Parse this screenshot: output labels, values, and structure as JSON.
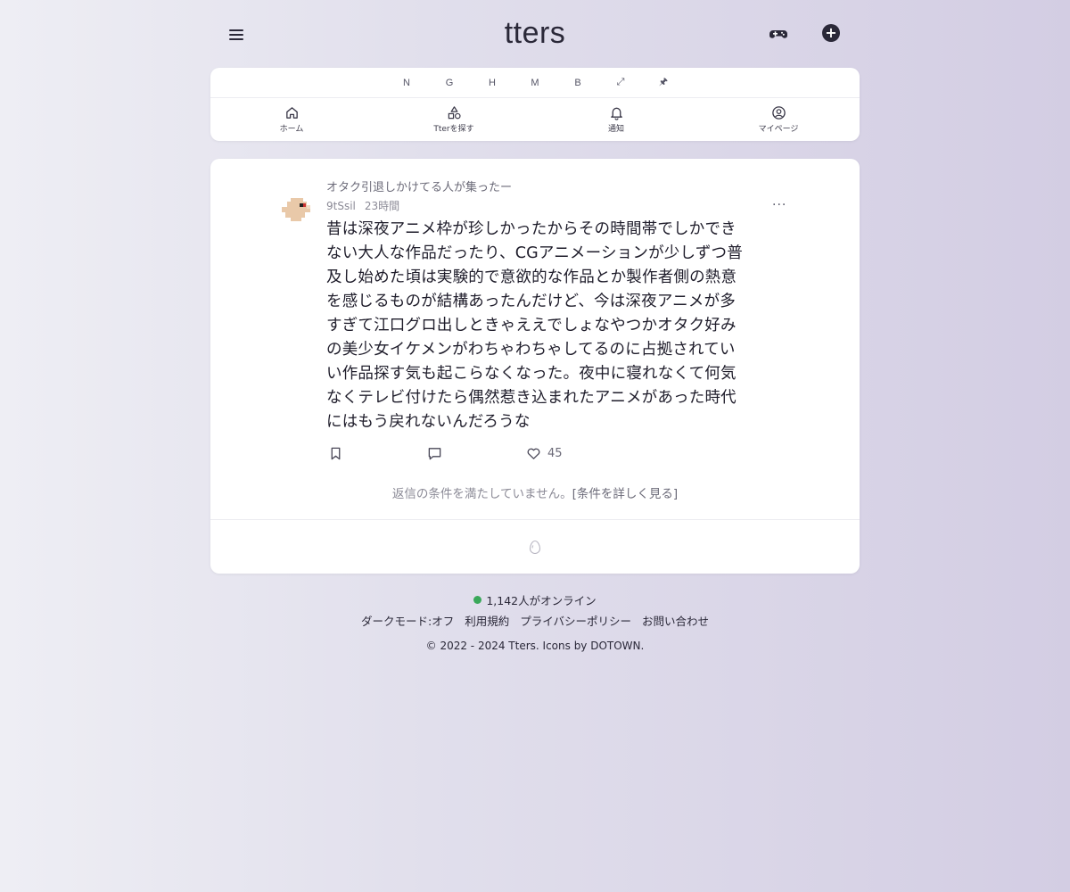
{
  "header": {
    "logo": "tters",
    "menu_icon": "hamburger-icon",
    "game_icon": "gamepad-icon",
    "create_icon": "plus-circle-icon",
    "create_glyph": "+"
  },
  "shortcuts": [
    "N",
    "G",
    "H",
    "M",
    "B",
    "⤢",
    "🖈"
  ],
  "tabs": [
    {
      "label": "ホーム",
      "icon": "home-icon"
    },
    {
      "label": "Tterを探す",
      "icon": "shapes-icon"
    },
    {
      "label": "通知",
      "icon": "bell-icon"
    },
    {
      "label": "マイページ",
      "icon": "user-circle-icon"
    }
  ],
  "post": {
    "board_title": "オタク引退しかけてる人が集ったー",
    "user_id": "9tSsil",
    "time": "23時間",
    "more": "···",
    "body": "昔は深夜アニメ枠が珍しかったからその時間帯でしかできない大人な作品だったり、CGアニメーションが少しずつ普及し始めた頃は実験的で意欲的な作品とか製作者側の熱意を感じるものが結構あったんだけど、今は深夜アニメが多すぎて江口グロ出しときゃええでしょなやつかオタク好みの美少女イケメンがわちゃわちゃしてるのに占拠されていい作品探す気も起こらなくなった。夜中に寝れなくて何気なくテレビ付けたら偶然惹き込まれたアニメがあった時代にはもう戻れないんだろうな",
    "like_count": "45",
    "reply_note": "返信の条件を満たしていません。",
    "reply_link": "[条件を詳しく見る]"
  },
  "footer": {
    "online": "1,142人がオンライン",
    "online_color": "#3aa85a",
    "links": [
      "ダークモード:オフ",
      "利用規約",
      "プライバシーポリシー",
      "お問い合わせ"
    ],
    "copyright": "© 2022 - 2024 Tters. Icons by DOTOWN."
  }
}
